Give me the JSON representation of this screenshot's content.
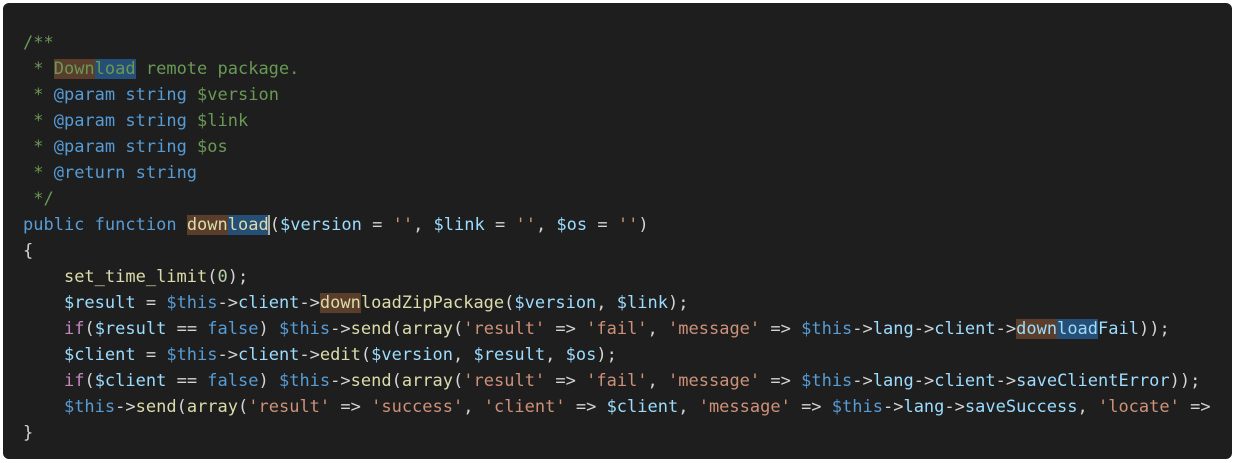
{
  "code_lines": [
    [
      {
        "t": "/**",
        "c": "c-comment"
      }
    ],
    [
      {
        "t": " * ",
        "c": "c-comment"
      },
      {
        "t": "Down",
        "c": "c-comment hl-a"
      },
      {
        "t": "load",
        "c": "c-comment hl-b"
      },
      {
        "t": " remote package.",
        "c": "c-comment"
      }
    ],
    [
      {
        "t": " * ",
        "c": "c-comment"
      },
      {
        "t": "@param",
        "c": "c-doctag"
      },
      {
        "t": " ",
        "c": "c-comment"
      },
      {
        "t": "string",
        "c": "c-doctag"
      },
      {
        "t": " $version",
        "c": "c-comment"
      }
    ],
    [
      {
        "t": " * ",
        "c": "c-comment"
      },
      {
        "t": "@param",
        "c": "c-doctag"
      },
      {
        "t": " ",
        "c": "c-comment"
      },
      {
        "t": "string",
        "c": "c-doctag"
      },
      {
        "t": " $link",
        "c": "c-comment"
      }
    ],
    [
      {
        "t": " * ",
        "c": "c-comment"
      },
      {
        "t": "@param",
        "c": "c-doctag"
      },
      {
        "t": " ",
        "c": "c-comment"
      },
      {
        "t": "string",
        "c": "c-doctag"
      },
      {
        "t": " $os",
        "c": "c-comment"
      }
    ],
    [
      {
        "t": " * ",
        "c": "c-comment"
      },
      {
        "t": "@return",
        "c": "c-doctag"
      },
      {
        "t": " ",
        "c": "c-comment"
      },
      {
        "t": "string",
        "c": "c-doctag"
      }
    ],
    [
      {
        "t": " */",
        "c": "c-comment"
      }
    ],
    [
      {
        "t": "public",
        "c": "c-keyword"
      },
      {
        "t": " ",
        "c": "c-punc"
      },
      {
        "t": "function",
        "c": "c-keyword"
      },
      {
        "t": " ",
        "c": "c-punc"
      },
      {
        "t": "down",
        "c": "c-func hl-a"
      },
      {
        "t": "load",
        "c": "c-func hl-b cursor-after"
      },
      {
        "t": "(",
        "c": "c-punc"
      },
      {
        "t": "$version",
        "c": "c-var"
      },
      {
        "t": " = ",
        "c": "c-op"
      },
      {
        "t": "''",
        "c": "c-string"
      },
      {
        "t": ", ",
        "c": "c-punc"
      },
      {
        "t": "$link",
        "c": "c-var"
      },
      {
        "t": " = ",
        "c": "c-op"
      },
      {
        "t": "''",
        "c": "c-string"
      },
      {
        "t": ", ",
        "c": "c-punc"
      },
      {
        "t": "$os",
        "c": "c-var"
      },
      {
        "t": " = ",
        "c": "c-op"
      },
      {
        "t": "''",
        "c": "c-string"
      },
      {
        "t": ")",
        "c": "c-punc"
      }
    ],
    [
      {
        "t": "{",
        "c": "c-punc"
      }
    ],
    [
      {
        "t": "    ",
        "c": "c-punc"
      },
      {
        "t": "set_time_limit",
        "c": "c-func"
      },
      {
        "t": "(",
        "c": "c-punc"
      },
      {
        "t": "0",
        "c": "c-number"
      },
      {
        "t": ");",
        "c": "c-punc"
      }
    ],
    [
      {
        "t": "    ",
        "c": "c-punc"
      },
      {
        "t": "$result",
        "c": "c-var"
      },
      {
        "t": " = ",
        "c": "c-op"
      },
      {
        "t": "$this",
        "c": "c-keyword"
      },
      {
        "t": "->",
        "c": "c-op"
      },
      {
        "t": "client",
        "c": "c-var"
      },
      {
        "t": "->",
        "c": "c-op"
      },
      {
        "t": "down",
        "c": "c-func hl-a"
      },
      {
        "t": "loadZipPackage",
        "c": "c-func"
      },
      {
        "t": "(",
        "c": "c-punc"
      },
      {
        "t": "$version",
        "c": "c-var"
      },
      {
        "t": ", ",
        "c": "c-punc"
      },
      {
        "t": "$link",
        "c": "c-var"
      },
      {
        "t": ");",
        "c": "c-punc"
      }
    ],
    [
      {
        "t": "    ",
        "c": "c-punc"
      },
      {
        "t": "if",
        "c": "c-control"
      },
      {
        "t": "(",
        "c": "c-punc"
      },
      {
        "t": "$result",
        "c": "c-var"
      },
      {
        "t": " == ",
        "c": "c-op"
      },
      {
        "t": "false",
        "c": "c-bool"
      },
      {
        "t": ") ",
        "c": "c-punc"
      },
      {
        "t": "$this",
        "c": "c-keyword"
      },
      {
        "t": "->",
        "c": "c-op"
      },
      {
        "t": "send",
        "c": "c-func"
      },
      {
        "t": "(",
        "c": "c-punc"
      },
      {
        "t": "array",
        "c": "c-func"
      },
      {
        "t": "(",
        "c": "c-punc"
      },
      {
        "t": "'result'",
        "c": "c-string"
      },
      {
        "t": " => ",
        "c": "c-op"
      },
      {
        "t": "'fail'",
        "c": "c-string"
      },
      {
        "t": ", ",
        "c": "c-punc"
      },
      {
        "t": "'message'",
        "c": "c-string"
      },
      {
        "t": " => ",
        "c": "c-op"
      },
      {
        "t": "$this",
        "c": "c-keyword"
      },
      {
        "t": "->",
        "c": "c-op"
      },
      {
        "t": "lang",
        "c": "c-var"
      },
      {
        "t": "->",
        "c": "c-op"
      },
      {
        "t": "client",
        "c": "c-var"
      },
      {
        "t": "->",
        "c": "c-op"
      },
      {
        "t": "down",
        "c": "c-var hl-a"
      },
      {
        "t": "load",
        "c": "c-var hl-b"
      },
      {
        "t": "Fail",
        "c": "c-var"
      },
      {
        "t": "));",
        "c": "c-punc"
      }
    ],
    [
      {
        "t": "    ",
        "c": "c-punc"
      },
      {
        "t": "$client",
        "c": "c-var"
      },
      {
        "t": " = ",
        "c": "c-op"
      },
      {
        "t": "$this",
        "c": "c-keyword"
      },
      {
        "t": "->",
        "c": "c-op"
      },
      {
        "t": "client",
        "c": "c-var"
      },
      {
        "t": "->",
        "c": "c-op"
      },
      {
        "t": "edit",
        "c": "c-func"
      },
      {
        "t": "(",
        "c": "c-punc"
      },
      {
        "t": "$version",
        "c": "c-var"
      },
      {
        "t": ", ",
        "c": "c-punc"
      },
      {
        "t": "$result",
        "c": "c-var"
      },
      {
        "t": ", ",
        "c": "c-punc"
      },
      {
        "t": "$os",
        "c": "c-var"
      },
      {
        "t": ");",
        "c": "c-punc"
      }
    ],
    [
      {
        "t": "    ",
        "c": "c-punc"
      },
      {
        "t": "if",
        "c": "c-control"
      },
      {
        "t": "(",
        "c": "c-punc"
      },
      {
        "t": "$client",
        "c": "c-var"
      },
      {
        "t": " == ",
        "c": "c-op"
      },
      {
        "t": "false",
        "c": "c-bool"
      },
      {
        "t": ") ",
        "c": "c-punc"
      },
      {
        "t": "$this",
        "c": "c-keyword"
      },
      {
        "t": "->",
        "c": "c-op"
      },
      {
        "t": "send",
        "c": "c-func"
      },
      {
        "t": "(",
        "c": "c-punc"
      },
      {
        "t": "array",
        "c": "c-func"
      },
      {
        "t": "(",
        "c": "c-punc"
      },
      {
        "t": "'result'",
        "c": "c-string"
      },
      {
        "t": " => ",
        "c": "c-op"
      },
      {
        "t": "'fail'",
        "c": "c-string"
      },
      {
        "t": ", ",
        "c": "c-punc"
      },
      {
        "t": "'message'",
        "c": "c-string"
      },
      {
        "t": " => ",
        "c": "c-op"
      },
      {
        "t": "$this",
        "c": "c-keyword"
      },
      {
        "t": "->",
        "c": "c-op"
      },
      {
        "t": "lang",
        "c": "c-var"
      },
      {
        "t": "->",
        "c": "c-op"
      },
      {
        "t": "client",
        "c": "c-var"
      },
      {
        "t": "->",
        "c": "c-op"
      },
      {
        "t": "saveClientError",
        "c": "c-var"
      },
      {
        "t": "));",
        "c": "c-punc"
      }
    ],
    [
      {
        "t": "    ",
        "c": "c-punc"
      },
      {
        "t": "$this",
        "c": "c-keyword"
      },
      {
        "t": "->",
        "c": "c-op"
      },
      {
        "t": "send",
        "c": "c-func"
      },
      {
        "t": "(",
        "c": "c-punc"
      },
      {
        "t": "array",
        "c": "c-func"
      },
      {
        "t": "(",
        "c": "c-punc"
      },
      {
        "t": "'result'",
        "c": "c-string"
      },
      {
        "t": " => ",
        "c": "c-op"
      },
      {
        "t": "'success'",
        "c": "c-string"
      },
      {
        "t": ", ",
        "c": "c-punc"
      },
      {
        "t": "'client'",
        "c": "c-string"
      },
      {
        "t": " => ",
        "c": "c-op"
      },
      {
        "t": "$client",
        "c": "c-var"
      },
      {
        "t": ", ",
        "c": "c-punc"
      },
      {
        "t": "'message'",
        "c": "c-string"
      },
      {
        "t": " => ",
        "c": "c-op"
      },
      {
        "t": "$this",
        "c": "c-keyword"
      },
      {
        "t": "->",
        "c": "c-op"
      },
      {
        "t": "lang",
        "c": "c-var"
      },
      {
        "t": "->",
        "c": "c-op"
      },
      {
        "t": "saveSuccess",
        "c": "c-var"
      },
      {
        "t": ", ",
        "c": "c-punc"
      },
      {
        "t": "'locate'",
        "c": "c-string"
      },
      {
        "t": " =>",
        "c": "c-op"
      }
    ],
    [
      {
        "t": "}",
        "c": "c-punc"
      }
    ]
  ],
  "colors": {
    "background": "#1e1e1e",
    "comment": "#6a9955",
    "keyword": "#569cd6",
    "function": "#dcdcaa",
    "variable": "#9cdcfe",
    "string": "#ce9178",
    "number": "#b5cea8",
    "control": "#c586c0"
  }
}
